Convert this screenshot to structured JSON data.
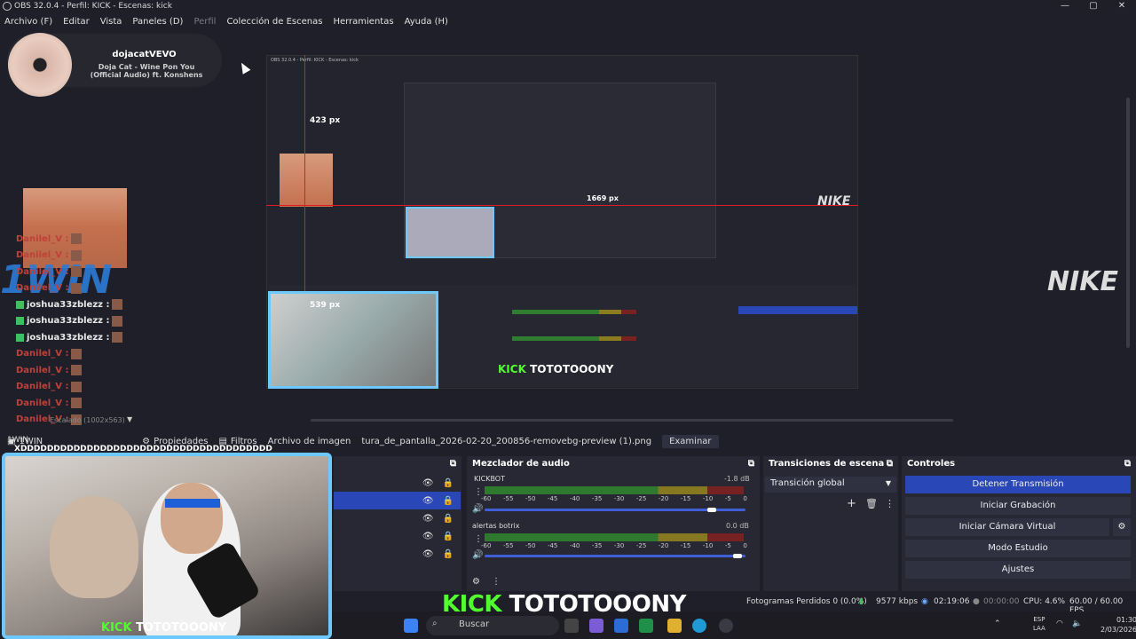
{
  "window": {
    "title": "OBS 32.0.4 - Perfil: KICK - Escenas: kick",
    "controls": [
      "—",
      "▢",
      "✕"
    ]
  },
  "menu": [
    "Archivo (F)",
    "Editar",
    "Vista",
    "Paneles (D)",
    "Perfil",
    "Colección de Escenas",
    "Herramientas",
    "Ayuda (H)"
  ],
  "now_playing": {
    "artist": "dojacatVEVO",
    "song": "Doja Cat - Wine Pon You (Official Audio) ft. Konshens"
  },
  "nested": {
    "title": "OBS 32.0.4 - Perfil: KICK - Escenas: kick",
    "measure_top": "423 px",
    "measure_right": "1669 px",
    "measure_cam": "539 px",
    "kick_tag": "KICK",
    "kick_name": "TOTOTOOONY"
  },
  "overlay": {
    "onewin": "1WIN",
    "nike": "NIKE",
    "nike_mid": "NIKE"
  },
  "chat": [
    {
      "user": "Danilel_V :",
      "kind": "red"
    },
    {
      "user": "Danilel_V :",
      "kind": "red"
    },
    {
      "user": "Danilel_V :",
      "kind": "red"
    },
    {
      "user": "Danilel_V :",
      "kind": "red"
    },
    {
      "user": "joshua33zblezz :",
      "kind": "green"
    },
    {
      "user": "joshua33zblezz :",
      "kind": "green"
    },
    {
      "user": "joshua33zblezz :",
      "kind": "green"
    },
    {
      "user": "Danilel_V :",
      "kind": "red"
    },
    {
      "user": "Danilel_V :",
      "kind": "red"
    },
    {
      "user": "Danilel_V :",
      "kind": "red"
    },
    {
      "user": "Danilel_V :",
      "kind": "red"
    },
    {
      "user": "Danilel_V :",
      "kind": "red"
    }
  ],
  "chat_strip": "XDDDDDDDDDDDDDDDDDDDDDDDDDDDDDDDDDDDDDD",
  "scaled_label": "Escalado (1002x563)",
  "source_bar": {
    "source_name": "1WIN",
    "properties": "Propiedades",
    "filters": "Filtros",
    "image_file": "Archivo de imagen",
    "file_path": "tura_de_pantalla_2026-02-20_200856-removebg-preview (1).png",
    "browse": "Examinar"
  },
  "mixer": {
    "title": "Mezclador de audio",
    "channels": [
      {
        "name": "KICKBOT",
        "db": "-1.8 dB",
        "volume": 0.9
      },
      {
        "name": "alertas botrix",
        "db": "0.0 dB",
        "volume": 1.0
      }
    ],
    "scale": [
      "-60",
      "-55",
      "-50",
      "-45",
      "-40",
      "-35",
      "-30",
      "-25",
      "-20",
      "-15",
      "-10",
      "-5",
      "0"
    ]
  },
  "transitions": {
    "title": "Transiciones de escena",
    "selected": "Transición global"
  },
  "controls": {
    "title": "Controles",
    "stop_stream": "Detener Transmisión",
    "start_recording": "Iniciar Grabación",
    "virtual_cam": "Iniciar Cámara Virtual",
    "studio_mode": "Modo Estudio",
    "settings": "Ajustes"
  },
  "status": {
    "dropped": "Fotogramas Perdidos 0 (0.0%)",
    "bitrate": "9577 kbps",
    "stream_time": "02:19:06",
    "rec_time": "00:00:00",
    "cpu": "CPU: 4.6%",
    "fps": "60.00 / 60.00 FPS"
  },
  "webcam": {
    "tag": "KICK",
    "name": "TOTOTOOONY"
  },
  "banner": {
    "tag": "KICK",
    "name": "TOTOTOOONY"
  },
  "taskbar": {
    "search": "Buscar",
    "lang1": "ESP",
    "lang2": "LAA",
    "time": "01:30",
    "date": "2/03/2026"
  },
  "colors": {
    "accent": "#2a47b8",
    "kick_green": "#52ff2e",
    "guide_red": "#e01b24",
    "cam_border": "#6cc8ff"
  }
}
